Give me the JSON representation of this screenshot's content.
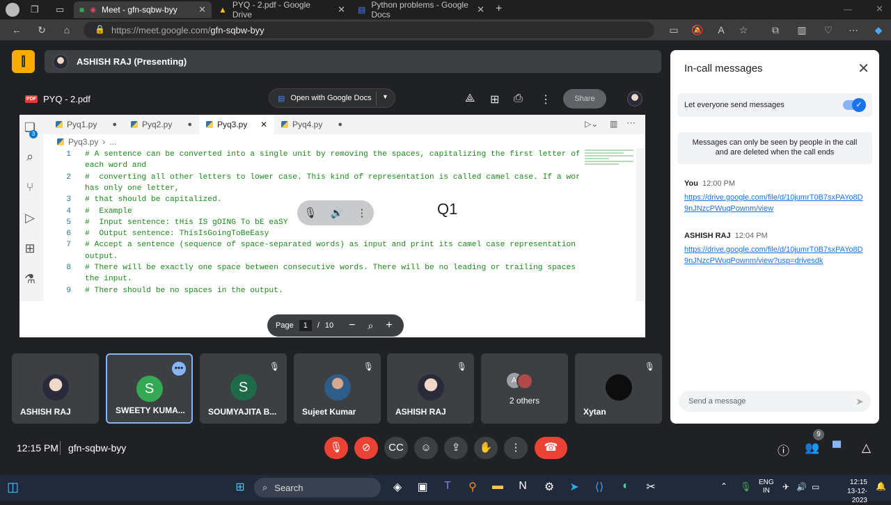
{
  "browser": {
    "tabs": [
      {
        "label": "Meet - gfn-sqbw-byy",
        "active": true
      },
      {
        "label": "PYQ - 2.pdf - Google Drive",
        "active": false
      },
      {
        "label": "Python problems - Google Docs",
        "active": false
      }
    ],
    "url_prefix": "https://meet.google.com/",
    "url_path": "gfn-sqbw-byy"
  },
  "meet": {
    "presenter": "ASHISH RAJ (Presenting)",
    "time": "12:15 PM",
    "meeting_code": "gfn-sqbw-byy",
    "people_count": "9"
  },
  "pdf": {
    "file_name": "PYQ - 2.pdf",
    "badge": "PDF",
    "open_with": "Open with Google Docs",
    "share": "Share",
    "page_label": "Page",
    "page_current": "1",
    "page_sep": "/",
    "page_total": "10"
  },
  "editor": {
    "tabs": [
      "Pyq1.py",
      "Pyq2.py",
      "Pyq3.py",
      "Pyq4.py"
    ],
    "active_tab": "Pyq3.py",
    "breadcrumb": "Pyq3.py",
    "breadcrumb_more": "...",
    "badge_count": "3",
    "lines": [
      {
        "n": "1",
        "text": "# A sentence can be converted into a single unit by removing the spaces, capitalizing the first letter of"
      },
      {
        "n": "",
        "text": "each word and"
      },
      {
        "n": "2",
        "text": "#  converting all other letters to lower case. This kind of representation is called camel case. If a word"
      },
      {
        "n": "",
        "text": "has only one letter,"
      },
      {
        "n": "3",
        "text": "# that should be capitalized."
      },
      {
        "n": "4",
        "text": "#  Example"
      },
      {
        "n": "5",
        "text": "#  Input sentence: tHis IS gOING To bE eaSY"
      },
      {
        "n": "6",
        "text": "#  Output sentence: ThisIsGoingToBeEasy"
      },
      {
        "n": "7",
        "text": "# Accept a sentence (sequence of space-separated words) as input and print its camel case representation as"
      },
      {
        "n": "",
        "text": "output."
      },
      {
        "n": "8",
        "text": "# There will be exactly one space between consecutive words. There will be no leading or trailing spaces in"
      },
      {
        "n": "",
        "text": "the input."
      },
      {
        "n": "9",
        "text": "# There should be no spaces in the output."
      }
    ],
    "overlay_label": "Q1"
  },
  "participants": [
    {
      "name": "ASHISH RAJ",
      "type": "photo"
    },
    {
      "name": "SWEETY KUMA...",
      "type": "letter",
      "letter": "S",
      "color": "#34a853"
    },
    {
      "name": "SOUMYAJITA B...",
      "type": "letter",
      "letter": "S",
      "color": "#1e6b4a"
    },
    {
      "name": "Sujeet Kumar",
      "type": "photo"
    },
    {
      "name": "ASHISH RAJ",
      "type": "photo"
    },
    {
      "name": "2 others",
      "type": "group",
      "letter": "A"
    },
    {
      "name": "Xytan",
      "type": "photo"
    }
  ],
  "chat": {
    "title": "In-call messages",
    "toggle_label": "Let everyone send messages",
    "notice": "Messages can only be seen by people in the call and are deleted when the call ends",
    "messages": [
      {
        "sender": "You",
        "time": "12:00 PM",
        "link": "https://drive.google.com/file/d/10jumrT0B7sxPAYo8D9nJNzcPWuqPownm/view"
      },
      {
        "sender": "ASHISH RAJ",
        "time": "12:04 PM",
        "link": "https://drive.google.com/file/d/10jumrT0B7sxPAYo8D9nJNzcPWuqPownm/view?usp=drivesdk"
      }
    ],
    "input_placeholder": "Send a message"
  },
  "taskbar": {
    "search": "Search",
    "lang1": "ENG",
    "lang2": "IN",
    "time": "12:15",
    "date": "13-12-2023"
  }
}
